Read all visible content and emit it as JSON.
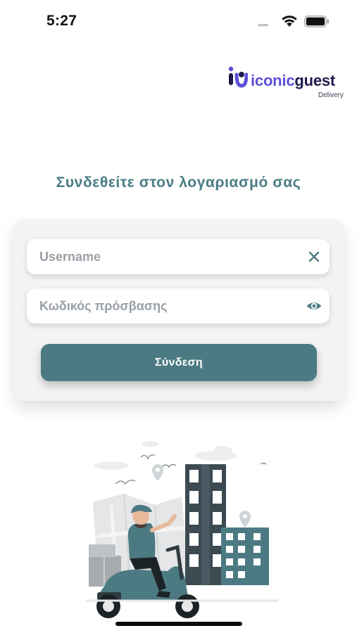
{
  "status_bar": {
    "time": "5:27",
    "signal": "••••",
    "icons": [
      "wifi-icon",
      "battery-icon"
    ]
  },
  "brand": {
    "name_part1": "iconic",
    "name_part2": "guest",
    "subtitle": "Delivery",
    "colors": {
      "primary": "#5b4fd8",
      "dark": "#1e1b4b"
    }
  },
  "login": {
    "heading": "Συνδεθείτε στον λογαριασμό σας",
    "username_placeholder": "Username",
    "password_placeholder": "Κωδικός πρόσβασης",
    "submit_label": "Σύνδεση",
    "username_action_icon": "close-icon",
    "password_action_icon": "eye-icon"
  },
  "illustration": {
    "subject": "delivery-scooter-illustration"
  },
  "colors": {
    "accent": "#4c7a82",
    "heading": "#4a7c84",
    "card": "#f3f3f3"
  }
}
